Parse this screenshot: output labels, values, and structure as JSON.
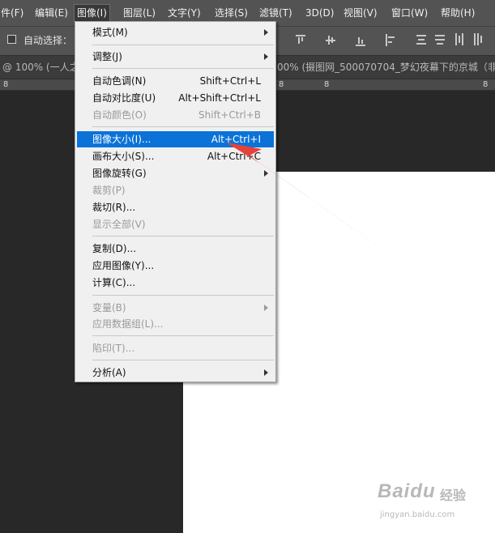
{
  "menubar": {
    "items": [
      "件(F)",
      "编辑(E)",
      "图像(I)",
      "图层(L)",
      "文字(Y)",
      "选择(S)",
      "滤镜(T)",
      "3D(D)",
      "视图(V)",
      "窗口(W)",
      "帮助(H)"
    ]
  },
  "toolbar": {
    "auto_select_label": "自动选择："
  },
  "tabs": {
    "left": "@ 100% (一人之",
    "right": "00% (摄图网_500070704_梦幻夜幕下的京城（非"
  },
  "ruler": {
    "numbers": [
      "8",
      "8",
      "8",
      "8"
    ]
  },
  "image_menu": {
    "items": [
      {
        "label": "模式(M)",
        "shortcut": "",
        "submenu": true,
        "enabled": true
      },
      {
        "label": "调整(J)",
        "shortcut": "",
        "submenu": true,
        "enabled": true
      },
      {
        "label": "自动色调(N)",
        "shortcut": "Shift+Ctrl+L",
        "submenu": false,
        "enabled": true
      },
      {
        "label": "自动对比度(U)",
        "shortcut": "Alt+Shift+Ctrl+L",
        "submenu": false,
        "enabled": true
      },
      {
        "label": "自动颜色(O)",
        "shortcut": "Shift+Ctrl+B",
        "submenu": false,
        "enabled": false
      },
      {
        "label": "图像大小(I)...",
        "shortcut": "Alt+Ctrl+I",
        "submenu": false,
        "enabled": true,
        "highlighted": true
      },
      {
        "label": "画布大小(S)...",
        "shortcut": "Alt+Ctrl+C",
        "submenu": false,
        "enabled": true
      },
      {
        "label": "图像旋转(G)",
        "shortcut": "",
        "submenu": true,
        "enabled": true
      },
      {
        "label": "裁剪(P)",
        "shortcut": "",
        "submenu": false,
        "enabled": false
      },
      {
        "label": "裁切(R)...",
        "shortcut": "",
        "submenu": false,
        "enabled": true
      },
      {
        "label": "显示全部(V)",
        "shortcut": "",
        "submenu": false,
        "enabled": false
      },
      {
        "label": "复制(D)...",
        "shortcut": "",
        "submenu": false,
        "enabled": true
      },
      {
        "label": "应用图像(Y)...",
        "shortcut": "",
        "submenu": false,
        "enabled": true
      },
      {
        "label": "计算(C)...",
        "shortcut": "",
        "submenu": false,
        "enabled": true
      },
      {
        "label": "变量(B)",
        "shortcut": "",
        "submenu": true,
        "enabled": false
      },
      {
        "label": "应用数据组(L)...",
        "shortcut": "",
        "submenu": false,
        "enabled": false
      },
      {
        "label": "陷印(T)...",
        "shortcut": "",
        "submenu": false,
        "enabled": false
      },
      {
        "label": "分析(A)",
        "shortcut": "",
        "submenu": true,
        "enabled": true
      }
    ]
  },
  "watermark": {
    "brand": "Baidu",
    "product": "经验",
    "url": "jingyan.baidu.com"
  },
  "colors": {
    "menubar_bg": "#535353",
    "workspace_bg": "#282828",
    "menu_bg": "#f0f0f0",
    "highlight": "#0b73d8",
    "annotation_arrow": "#e8413a"
  },
  "icons": {
    "menu_submenu": "chevron-right-icon",
    "toolbar_alignment": "align-icons",
    "annotation": "red-arrow-icon"
  }
}
